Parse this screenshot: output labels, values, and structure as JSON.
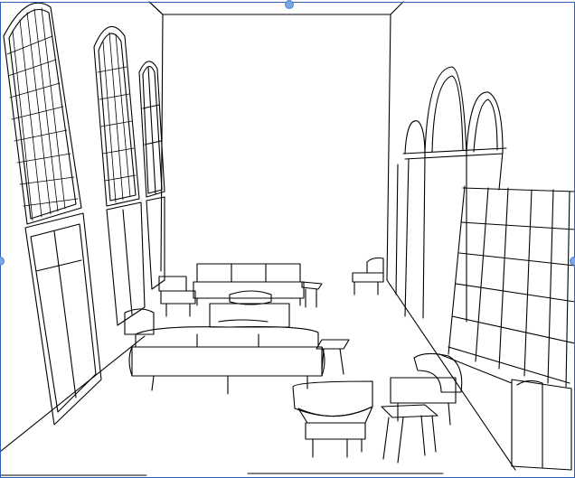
{
  "viewport": {
    "kind": "3d-line-drawing",
    "line_color": "#000000",
    "background": "#ffffff",
    "selection_color": "#2f5fb3",
    "handle_color": "#7aa7e6"
  },
  "icons": {
    "handle_top": "resize-handle-icon",
    "handle_left": "resize-handle-icon",
    "handle_right": "resize-handle-icon"
  }
}
